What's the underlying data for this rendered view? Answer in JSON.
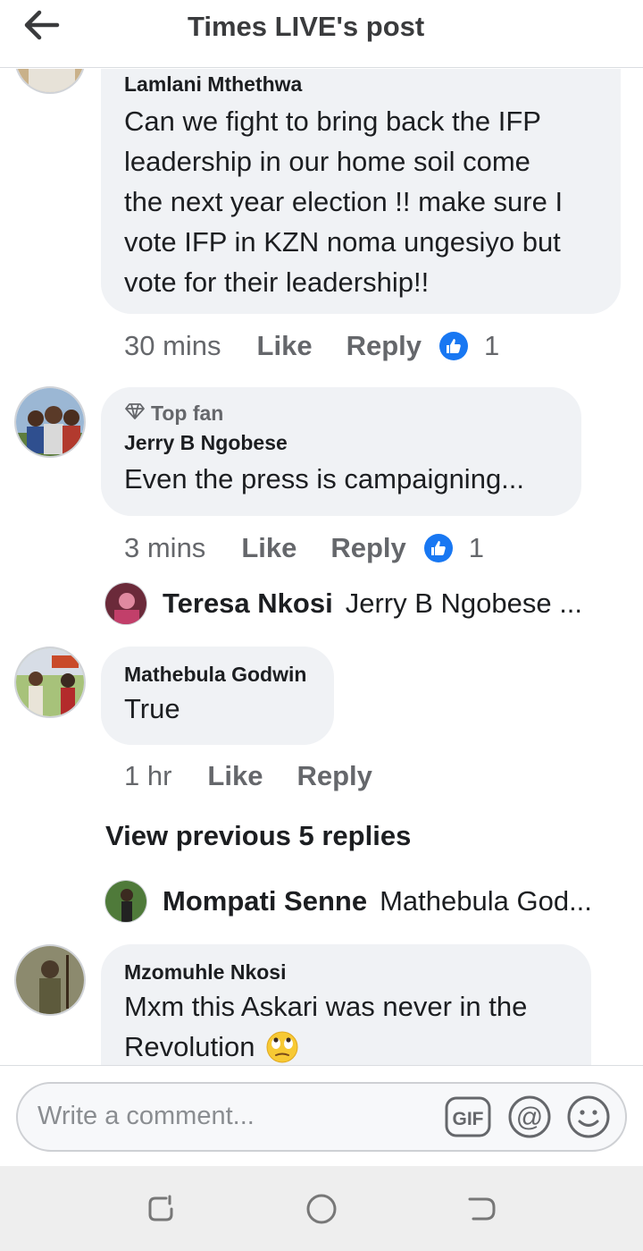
{
  "header": {
    "title": "Times LIVE's post"
  },
  "comments": [
    {
      "name": "Lamlani Mthethwa",
      "lines": [
        "Can we  fight to bring back the IFP",
        "leadership in our home soil come",
        "the next year election !! make sure I",
        "vote IFP in KZN noma ungesiyo but",
        "vote for their leadership!!"
      ],
      "time": "30 mins",
      "like": "Like",
      "reply": "Reply",
      "likes": "1"
    },
    {
      "badge": "Top fan",
      "name": "Jerry B Ngobese",
      "lines": [
        "Even the press is campaigning..."
      ],
      "time": "3 mins",
      "like": "Like",
      "reply": "Reply",
      "likes": "1",
      "reply_preview": {
        "name": "Teresa Nkosi",
        "text": "Jerry B Ngobese  ..."
      }
    },
    {
      "name": "Mathebula Godwin",
      "lines": [
        "True"
      ],
      "time": "1 hr",
      "like": "Like",
      "reply": "Reply",
      "view_previous": "View previous 5 replies",
      "reply_preview": {
        "name": "Mompati Senne",
        "text": "Mathebula God..."
      }
    },
    {
      "name": "Mzomuhle Nkosi",
      "lines": [
        "Mxm this Askari was never in the",
        "Revolution"
      ]
    }
  ],
  "composer": {
    "placeholder": "Write a comment..."
  },
  "icons": {
    "back": "back-arrow-icon",
    "top_fan": "diamond-icon",
    "like_badge": "thumbs-up-icon",
    "gif": "gif-icon",
    "mention": "at-sign-icon",
    "emoji": "smiley-icon",
    "eye_roll": "eye-roll-emoji-icon",
    "recents": "recents-icon",
    "home": "home-icon",
    "back_nav": "nav-back-icon"
  },
  "colors": {
    "accent": "#1877f2",
    "bubble": "#f0f2f5",
    "muted": "#65676b"
  }
}
